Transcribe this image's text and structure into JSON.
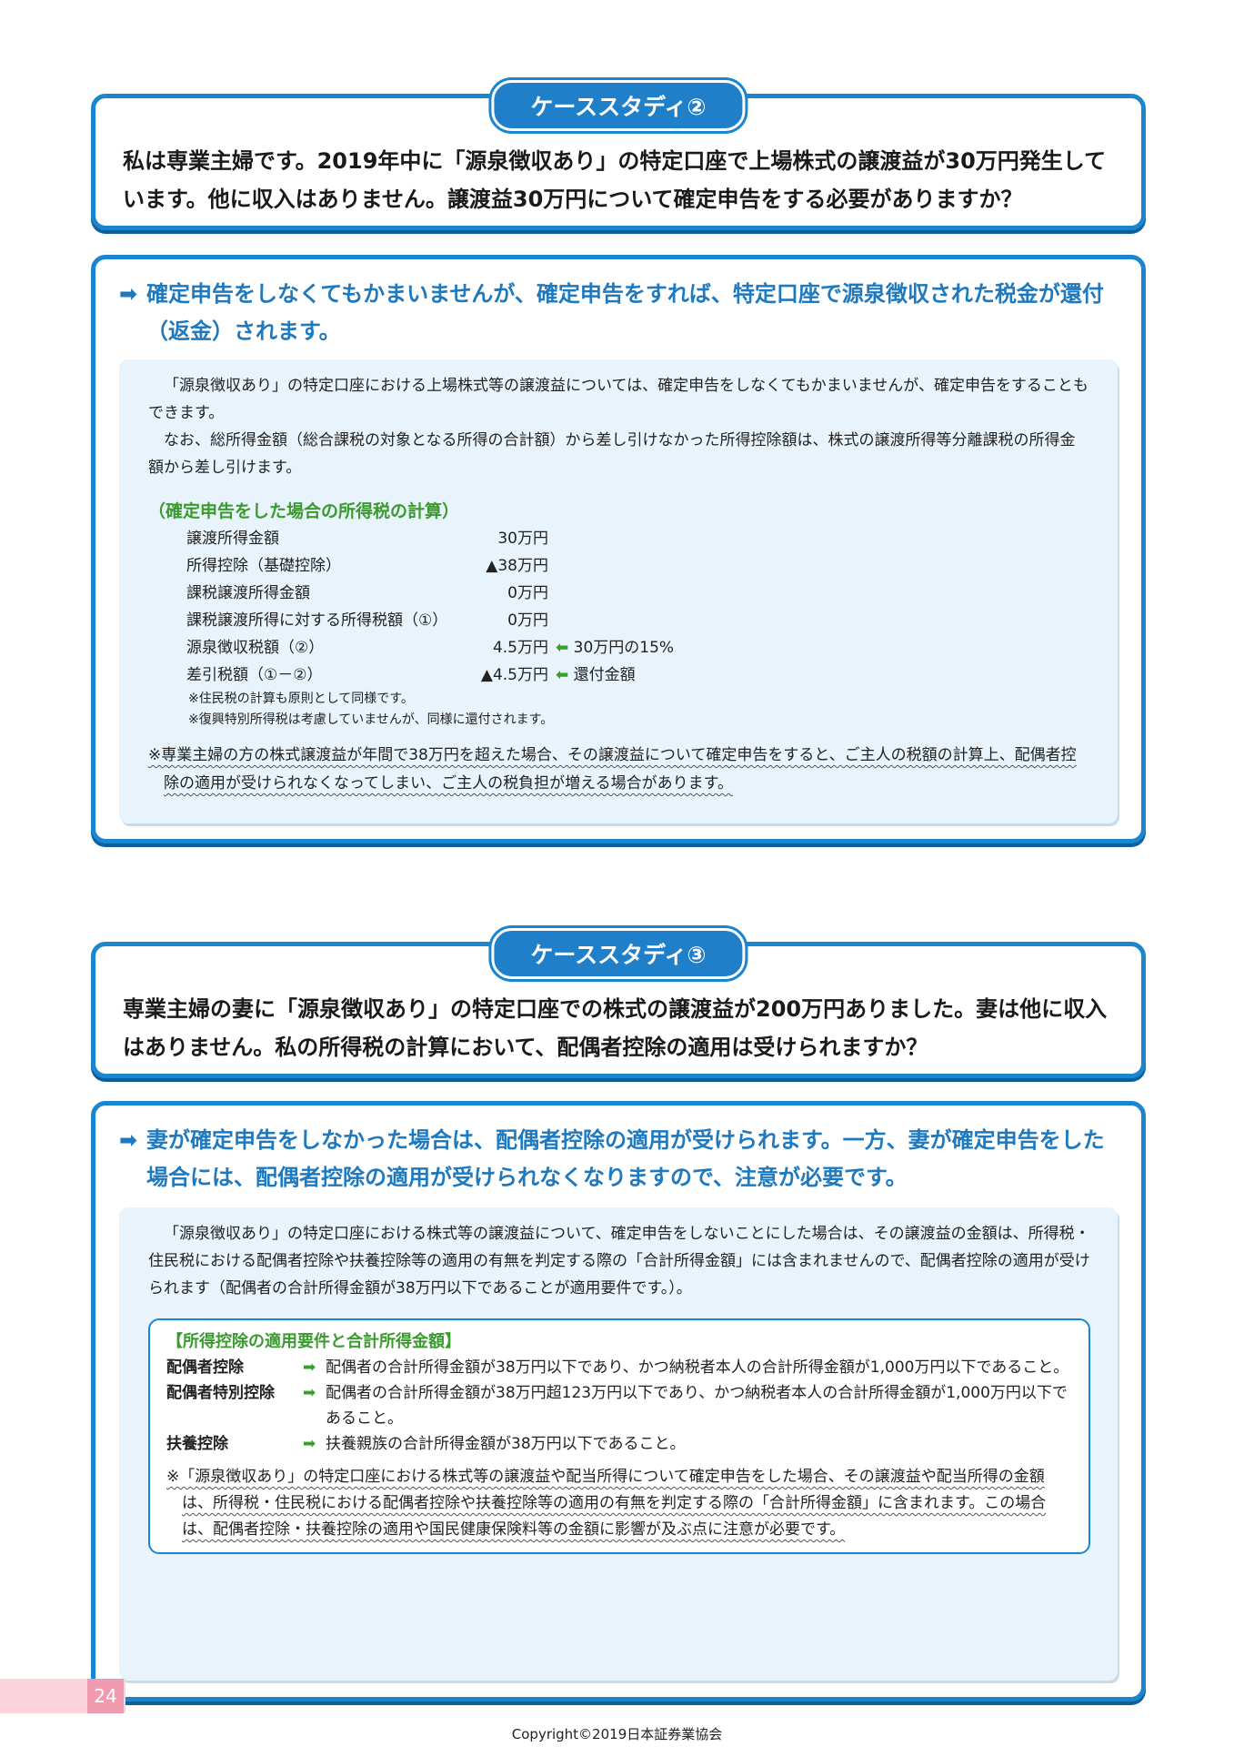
{
  "case2": {
    "tag": "ケーススタディ②",
    "question": "私は専業主婦です。2019年中に「源泉徴収あり」の特定口座で上場株式の譲渡益が30万円発生しています。他に収入はありません。譲渡益30万円について確定申告をする必要がありますか？",
    "answer_arrow": "➡",
    "answer": "確定申告をしなくてもかまいませんが、確定申告をすれば、特定口座で源泉徴収された税金が還付（返金）されます。",
    "para1": "「源泉徴収あり」の特定口座における上場株式等の譲渡益については、確定申告をしなくてもかまいませんが、確定申告をすることもできます。",
    "para2": "なお、総所得金額（総合課税の対象となる所得の合計額）から差し引けなかった所得控除額は、株式の譲渡所得等分離課税の所得金額から差し引けます。",
    "calc_title": "（確定申告をした場合の所得税の計算）",
    "calc_rows": [
      {
        "label": "譲渡所得金額",
        "value": "30万円",
        "note": ""
      },
      {
        "label": "所得控除（基礎控除）",
        "value": "▲38万円",
        "note": ""
      },
      {
        "label": "課税譲渡所得金額",
        "value": "0万円",
        "note": ""
      },
      {
        "label": "課税譲渡所得に対する所得税額（①）",
        "value": "0万円",
        "note": ""
      },
      {
        "label": "源泉徴収税額（②）",
        "value": "4.5万円",
        "note": "30万円の15%"
      },
      {
        "label": "差引税額（①－②）",
        "value": "▲4.5万円",
        "note": "還付金額"
      }
    ],
    "note_arrow": "⬅",
    "small_note1": "※住民税の計算も原則として同様です。",
    "small_note2": "※復興特別所得税は考慮していませんが、同様に還付されます。",
    "caution": "※専業主婦の方の株式譲渡益が年間で38万円を超えた場合、その譲渡益について確定申告をすると、ご主人の税額の計算上、配偶者控除の適用が受けられなくなってしまい、ご主人の税負担が増える場合があります。"
  },
  "case3": {
    "tag": "ケーススタディ③",
    "question": "専業主婦の妻に「源泉徴収あり」の特定口座での株式の譲渡益が200万円ありました。妻は他に収入はありません。私の所得税の計算において、配偶者控除の適用は受けられますか？",
    "answer_arrow": "➡",
    "answer": "妻が確定申告をしなかった場合は、配偶者控除の適用が受けられます。一方、妻が確定申告をした場合には、配偶者控除の適用が受けられなくなりますので、注意が必要です。",
    "para1": "「源泉徴収あり」の特定口座における株式等の譲渡益について、確定申告をしないことにした場合は、その譲渡益の金額は、所得税・住民税における配偶者控除や扶養控除等の適用の有無を判定する際の「合計所得金額」には含まれませんので、配偶者控除の適用が受けられます（配偶者の合計所得金額が38万円以下であることが適用要件です。）。",
    "req_title": "【所得控除の適用要件と合計所得金額】",
    "req_arrow": "➡",
    "req_rows": [
      {
        "label": "配偶者控除",
        "text": "配偶者の合計所得金額が38万円以下であり、かつ納税者本人の合計所得金額が1,000万円以下であること。"
      },
      {
        "label": "配偶者特別控除",
        "text": "配偶者の合計所得金額が38万円超123万円以下であり、かつ納税者本人の合計所得金額が1,000万円以下であること。"
      },
      {
        "label": "扶養控除",
        "text": "扶養親族の合計所得金額が38万円以下であること。"
      }
    ],
    "caution": "※「源泉徴収あり」の特定口座における株式等の譲渡益や配当所得について確定申告をした場合、その譲渡益や配当所得の金額は、所得税・住民税における配偶者控除や扶養控除等の適用の有無を判定する際の「合計所得金額」に含まれます。この場合は、配偶者控除・扶養控除の適用や国民健康保険料等の金額に影響が及ぶ点に注意が必要です。"
  },
  "footer": {
    "page_number": "24",
    "copyright": "Copyright©2019日本証券業協会"
  }
}
